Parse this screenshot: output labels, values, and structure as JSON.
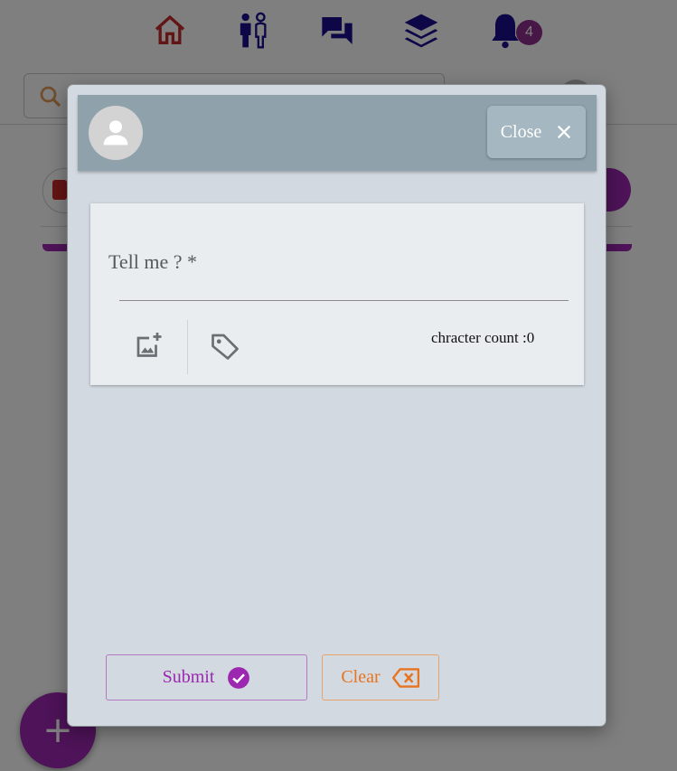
{
  "nav": {
    "badge_count": "4",
    "icons": [
      "home-icon",
      "people-icon",
      "chat-icon",
      "layers-icon",
      "bell-icon"
    ]
  },
  "modal": {
    "close_label": "Close",
    "field_label": "Tell me ?  *",
    "char_count_label": "chracter count :0",
    "submit_label": "Submit",
    "clear_label": "Clear"
  },
  "colors": {
    "accent": "#9c27b0",
    "nav_icon": "#1a0d8e",
    "home_icon": "#c62828",
    "clear": "#e8741f",
    "header": "#8fa2ac"
  }
}
